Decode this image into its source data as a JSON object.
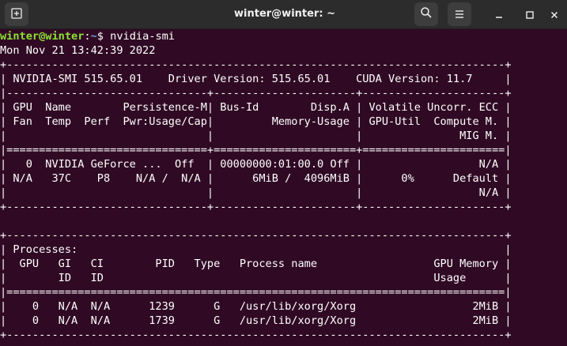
{
  "window": {
    "title": "winter@winter: ~",
    "icons": {
      "new_tab": "new-tab-icon",
      "search": "search-icon",
      "menu": "hamburger-menu-icon",
      "minimize": "minimize-icon",
      "maximize": "maximize-icon",
      "close": "close-icon"
    }
  },
  "colors": {
    "terminal_bg": "#300a24",
    "titlebar_bg": "#2c2c2c",
    "prompt_user": "#8ae234",
    "prompt_path": "#729fcf",
    "text": "#ffffff"
  },
  "prompt": {
    "user_host": "winter@winter",
    "separator": ":",
    "path": "~",
    "symbol": "$",
    "command": " nvidia-smi"
  },
  "output": {
    "timestamp": "Mon Nov 21 13:42:39 2022",
    "smi_table": [
      "+-----------------------------------------------------------------------------+",
      "| NVIDIA-SMI 515.65.01    Driver Version: 515.65.01    CUDA Version: 11.7     |",
      "|-------------------------------+----------------------+----------------------+",
      "| GPU  Name        Persistence-M| Bus-Id        Disp.A | Volatile Uncorr. ECC |",
      "| Fan  Temp  Perf  Pwr:Usage/Cap|         Memory-Usage | GPU-Util  Compute M. |",
      "|                               |                      |               MIG M. |",
      "|===============================+======================+======================|",
      "|   0  NVIDIA GeForce ...  Off  | 00000000:01:00.0 Off |                  N/A |",
      "| N/A   37C    P8    N/A /  N/A |      6MiB /  4096MiB |      0%      Default |",
      "|                               |                      |                  N/A |",
      "+-------------------------------+----------------------+----------------------+"
    ],
    "processes_table": [
      "+-----------------------------------------------------------------------------+",
      "| Processes:                                                                  |",
      "|  GPU   GI   CI        PID   Type   Process name                  GPU Memory |",
      "|        ID   ID                                                   Usage      |",
      "|=============================================================================|",
      "|    0   N/A  N/A      1239      G   /usr/lib/xorg/Xorg                  2MiB |",
      "|    0   N/A  N/A      1739      G   /usr/lib/xorg/Xorg                  2MiB |",
      "+-----------------------------------------------------------------------------+"
    ]
  }
}
